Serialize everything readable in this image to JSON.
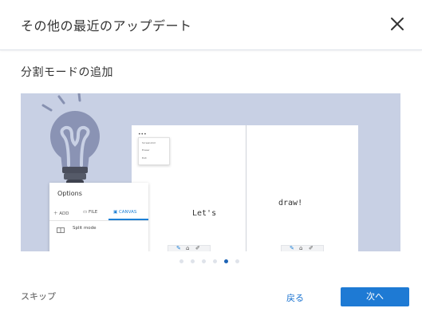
{
  "dialog": {
    "title": "その他の最近のアップデート",
    "close_icon": "close-icon"
  },
  "feature": {
    "title": "分割モードの追加"
  },
  "preview": {
    "background": "#c8d0e4",
    "left_page_text": "Let's",
    "right_page_text": "draw!",
    "mini_menu_items": [
      "Screenshot",
      "Eraser",
      "Exit"
    ],
    "options_panel": {
      "title": "Options",
      "tabs": [
        {
          "icon": "plus-icon",
          "label": "ADD"
        },
        {
          "icon": "file-icon",
          "label": "FILE"
        },
        {
          "icon": "canvas-icon",
          "label": "CANVAS"
        }
      ],
      "active_tab": "CANVAS",
      "item_label": "Split mode",
      "item_icon": "split-view-icon"
    }
  },
  "pagination": {
    "count": 6,
    "active_index": 4,
    "active_color": "#1d63b5"
  },
  "footer": {
    "skip_label": "スキップ",
    "back_label": "戻る",
    "next_label": "次へ",
    "accent_color": "#1e7ad4"
  }
}
